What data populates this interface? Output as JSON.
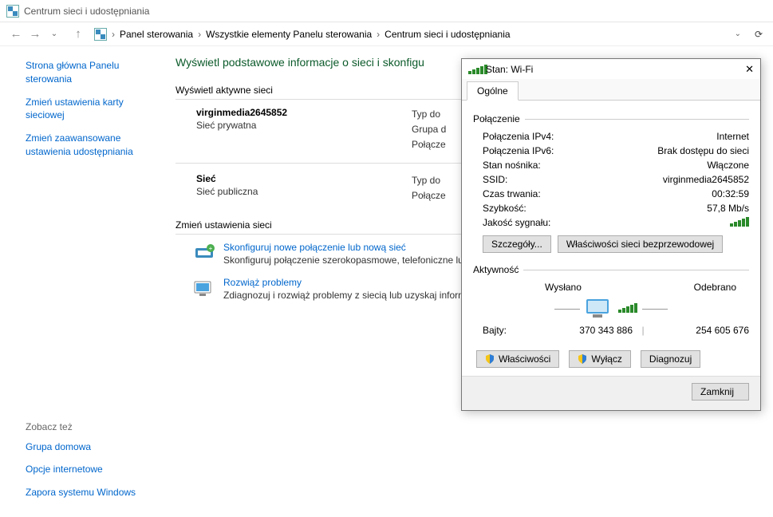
{
  "titlebar": {
    "title": "Centrum sieci i udostępniania"
  },
  "breadcrumb": {
    "items": [
      "Panel sterowania",
      "Wszystkie elementy Panelu sterowania",
      "Centrum sieci i udostępniania"
    ]
  },
  "sidebar": {
    "links": {
      "home": "Strona główna Panelu sterowania",
      "adapter": "Zmień ustawienia karty sieciowej",
      "sharing": "Zmień zaawansowane ustawienia udostępniania"
    },
    "footer": {
      "heading": "Zobacz też",
      "homegroup": "Grupa domowa",
      "inet": "Opcje internetowe",
      "firewall": "Zapora systemu Windows"
    }
  },
  "main": {
    "heading": "Wyświetl podstawowe informacje o sieci i skonfigu",
    "active_label": "Wyświetl aktywne sieci",
    "net1": {
      "name": "virginmedia2645852",
      "type": "Sieć prywatna",
      "right": [
        "Typ do",
        "Grupa d",
        "Połącze"
      ]
    },
    "net2": {
      "name": "Sieć",
      "type": "Sieć publiczna",
      "right": [
        "Typ do",
        "Połącze"
      ]
    },
    "change_label": "Zmień ustawienia sieci",
    "task1": {
      "title": "Skonfiguruj nowe połączenie lub nową sieć",
      "desc": "Skonfiguruj połączenie szerokopasmowe, telefoniczne lu dostępu."
    },
    "task2": {
      "title": "Rozwiąż problemy",
      "desc": "Zdiagnozuj i rozwiąż problemy z siecią lub uzyskaj inforn"
    }
  },
  "dialog": {
    "title": "Stan: Wi-Fi",
    "tab": "Ogólne",
    "conn_label": "Połączenie",
    "kv": {
      "ipv4_k": "Połączenia IPv4:",
      "ipv4_v": "Internet",
      "ipv6_k": "Połączenia IPv6:",
      "ipv6_v": "Brak dostępu do sieci",
      "media_k": "Stan nośnika:",
      "media_v": "Włączone",
      "ssid_k": "SSID:",
      "ssid_v": "virginmedia2645852",
      "dur_k": "Czas trwania:",
      "dur_v": "00:32:59",
      "speed_k": "Szybkość:",
      "speed_v": "57,8 Mb/s",
      "sig_k": "Jakość sygnału:"
    },
    "btn_details": "Szczegóły...",
    "btn_wprops": "Właściwości sieci bezprzewodowej",
    "activity_label": "Aktywność",
    "sent_label": "Wysłano",
    "recv_label": "Odebrano",
    "bytes_k": "Bajty:",
    "bytes_sent": "370 343 886",
    "bytes_recv": "254 605 676",
    "btn_props": "Właściwości",
    "btn_disable": "Wyłącz",
    "btn_diag": "Diagnozuj",
    "btn_close": "Zamknij"
  }
}
